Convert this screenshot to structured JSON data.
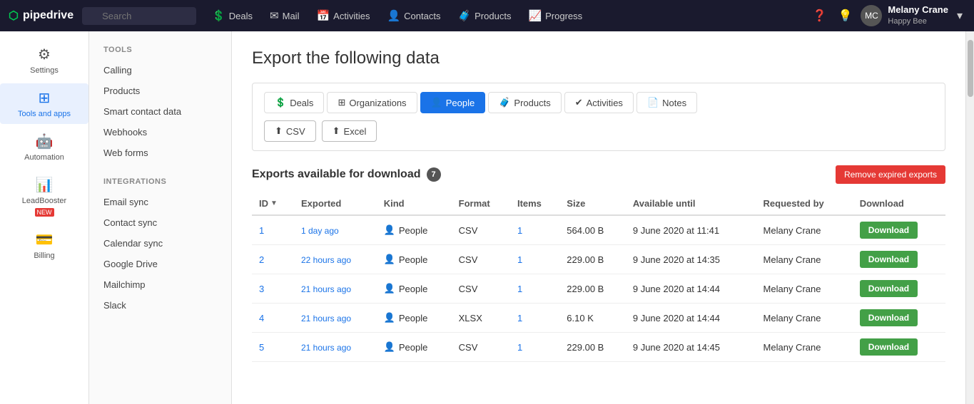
{
  "app": {
    "logo_text": "pipedrive",
    "logo_icon": "●"
  },
  "topnav": {
    "search_placeholder": "Search",
    "nav_items": [
      {
        "label": "Deals",
        "icon": "💲"
      },
      {
        "label": "Mail",
        "icon": "✉"
      },
      {
        "label": "Activities",
        "icon": "📅"
      },
      {
        "label": "Contacts",
        "icon": "👤"
      },
      {
        "label": "Products",
        "icon": "🧳"
      },
      {
        "label": "Progress",
        "icon": "📈"
      }
    ],
    "help_icon": "?",
    "bulb_icon": "💡",
    "user": {
      "name": "Melany Crane",
      "company": "Happy Bee",
      "avatar_initials": "MC"
    }
  },
  "sidebar": {
    "items": [
      {
        "label": "Settings",
        "icon": "⚙",
        "active": false
      },
      {
        "label": "Tools and apps",
        "icon": "⊞",
        "active": true
      },
      {
        "label": "Automation",
        "icon": "🤖",
        "active": false
      },
      {
        "label": "LeadBooster",
        "icon": "📊",
        "active": false,
        "badge": "NEW"
      },
      {
        "label": "Billing",
        "icon": "💳",
        "active": false
      }
    ]
  },
  "tools_menu": {
    "section1_title": "TOOLS",
    "section1_items": [
      {
        "label": "Calling"
      },
      {
        "label": "Products"
      },
      {
        "label": "Smart contact data"
      },
      {
        "label": "Webhooks"
      },
      {
        "label": "Web forms"
      }
    ],
    "section2_title": "INTEGRATIONS",
    "section2_items": [
      {
        "label": "Email sync"
      },
      {
        "label": "Contact sync"
      },
      {
        "label": "Calendar sync"
      },
      {
        "label": "Google Drive"
      },
      {
        "label": "Mailchimp"
      },
      {
        "label": "Slack"
      }
    ]
  },
  "main": {
    "page_title": "Export the following data",
    "tabs": [
      {
        "label": "Deals",
        "icon": "💲",
        "active": false
      },
      {
        "label": "Organizations",
        "icon": "⊞",
        "active": false
      },
      {
        "label": "People",
        "icon": "👤",
        "active": true
      },
      {
        "label": "Products",
        "icon": "🧳",
        "active": false
      },
      {
        "label": "Activities",
        "icon": "✔",
        "active": false
      },
      {
        "label": "Notes",
        "icon": "📄",
        "active": false
      }
    ],
    "format_buttons": [
      {
        "label": "CSV",
        "icon": "⬆"
      },
      {
        "label": "Excel",
        "icon": "⬆"
      }
    ],
    "exports_title": "Exports available for download",
    "exports_count": "7",
    "remove_btn_label": "Remove expired exports",
    "table": {
      "columns": [
        "ID",
        "Exported",
        "Kind",
        "Format",
        "Items",
        "Size",
        "Available until",
        "Requested by",
        "Download"
      ],
      "rows": [
        {
          "id": "1",
          "exported": "1 day ago",
          "kind": "People",
          "format": "CSV",
          "items": "1",
          "size": "564.00 B",
          "available_until": "9 June 2020 at 11:41",
          "requested_by": "Melany Crane",
          "download_label": "Download"
        },
        {
          "id": "2",
          "exported": "22 hours ago",
          "kind": "People",
          "format": "CSV",
          "items": "1",
          "size": "229.00 B",
          "available_until": "9 June 2020 at 14:35",
          "requested_by": "Melany Crane",
          "download_label": "Download"
        },
        {
          "id": "3",
          "exported": "21 hours ago",
          "kind": "People",
          "format": "CSV",
          "items": "1",
          "size": "229.00 B",
          "available_until": "9 June 2020 at 14:44",
          "requested_by": "Melany Crane",
          "download_label": "Download"
        },
        {
          "id": "4",
          "exported": "21 hours ago",
          "kind": "People",
          "format": "XLSX",
          "items": "1",
          "size": "6.10 K",
          "available_until": "9 June 2020 at 14:44",
          "requested_by": "Melany Crane",
          "download_label": "Download"
        },
        {
          "id": "5",
          "exported": "21 hours ago",
          "kind": "People",
          "format": "CSV",
          "items": "1",
          "size": "229.00 B",
          "available_until": "9 June 2020 at 14:45",
          "requested_by": "Melany Crane",
          "download_label": "Download"
        }
      ]
    }
  }
}
